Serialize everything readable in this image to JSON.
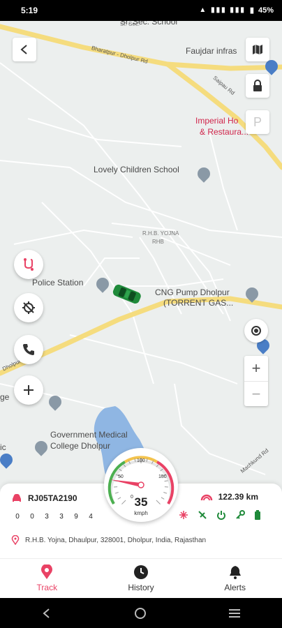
{
  "status_bar": {
    "time": "5:19",
    "signal": "VoLTE",
    "battery": "45%"
  },
  "map": {
    "labels": {
      "school_top": "Sr. Sec. School",
      "school_top_sub": "Sr. Sec.",
      "faujdar": "Faujdar infras",
      "imperial": "Imperial Ho",
      "imperial2": "& Restaura...",
      "lovely": "Lovely Children School",
      "rhb": "R.H.B. YOJNA",
      "rhb2": "RHB",
      "police": "Police Station",
      "cng": "CNG Pump Dholpur",
      "cng2": "(TORRENT GAS...",
      "govt": "Government Medical",
      "govt2": "College Dholpur",
      "ge": "ge",
      "ic": "ic",
      "road_bharatpur": "Bharatpur - Dholpur Rd",
      "road_saipau": "Saipau Rd",
      "road_dholpur": "Dholpur Rd",
      "road_machkund": "Machkund Rd"
    },
    "parking_label": "P"
  },
  "vehicle": {
    "id": "RJ05TA2190",
    "odometer": [
      "0",
      "0",
      "3",
      "3",
      "9",
      "4"
    ],
    "distance": "122.39 km",
    "address": "R.H.B. Yojna, Dhaulpur, 328001, Dholpur, India, Rajasthan"
  },
  "speedometer": {
    "speed": 35,
    "unit": "kmph",
    "ticks": [
      "0",
      "50",
      "100",
      "150"
    ],
    "max": 200
  },
  "nav": {
    "track": "Track",
    "history": "History",
    "alerts": "Alerts"
  },
  "colors": {
    "accent": "#e94265",
    "road": "#f5dc7e",
    "vehicle": "#1f8a3a",
    "water": "#8fb6e3"
  }
}
